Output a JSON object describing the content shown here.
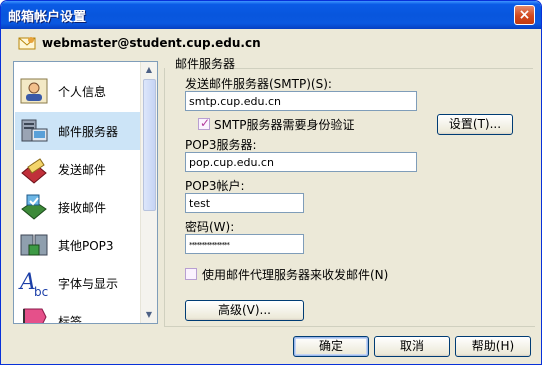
{
  "window": {
    "title": "邮箱帐户设置",
    "close_glyph": "×"
  },
  "account": {
    "email": "webmaster@student.cup.edu.cn",
    "icon": "mail-account-icon"
  },
  "sidebar": {
    "items": [
      {
        "label": "个人信息",
        "icon": "person-card-icon",
        "selected": false
      },
      {
        "label": "邮件服务器",
        "icon": "mail-server-icon",
        "selected": true
      },
      {
        "label": "发送邮件",
        "icon": "send-mail-icon",
        "selected": false
      },
      {
        "label": "接收邮件",
        "icon": "receive-mail-icon",
        "selected": false
      },
      {
        "label": "其他POP3",
        "icon": "other-pop3-icon",
        "selected": false
      },
      {
        "label": "字体与显示",
        "icon": "font-display-icon",
        "selected": false
      },
      {
        "label": "标签",
        "icon": "tag-icon",
        "selected": false
      }
    ]
  },
  "panel": {
    "group_title": "邮件服务器",
    "smtp_label": "发送邮件服务器(SMTP)(S):",
    "smtp_value": "smtp.cup.edu.cn",
    "smtp_auth_label": "SMTP服务器需要身份验证",
    "smtp_auth_checked": true,
    "settings_button": "设置(T)...",
    "pop3_label": "POP3服务器:",
    "pop3_value": "pop.cup.edu.cn",
    "pop3_account_label": "POP3帐户:",
    "pop3_account_value": "test",
    "password_label": "密码(W):",
    "password_value": "****************",
    "proxy_label": "使用邮件代理服务器来收发邮件(N)",
    "proxy_checked": false,
    "advanced_button": "高级(V)..."
  },
  "footer": {
    "ok": "确定",
    "cancel": "取消",
    "help": "帮助(H)"
  },
  "colors": {
    "titlebar": "#0856dd",
    "selected_bg": "#cce4f7",
    "dialog_bg": "#ece9d8",
    "check_color": "#b33a9c"
  }
}
